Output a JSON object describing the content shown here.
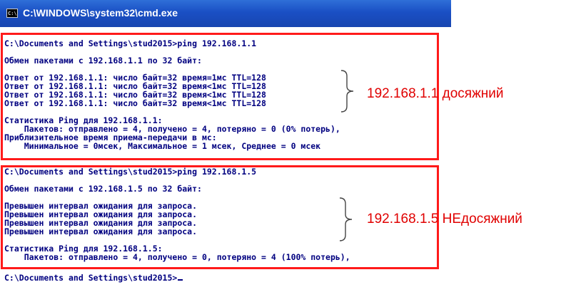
{
  "window": {
    "title": "C:\\WINDOWS\\system32\\cmd.exe",
    "icon_label": "C:\\"
  },
  "console": {
    "lines": [
      "C:\\Documents and Settings\\stud2015>ping 192.168.1.1",
      "",
      "Обмен пакетами с 192.168.1.1 по 32 байт:",
      "",
      "Ответ от 192.168.1.1: число байт=32 время=1мс TTL=128",
      "Ответ от 192.168.1.1: число байт=32 время<1мс TTL=128",
      "Ответ от 192.168.1.1: число байт=32 время<1мс TTL=128",
      "Ответ от 192.168.1.1: число байт=32 время<1мс TTL=128",
      "",
      "Статистика Ping для 192.168.1.1:",
      "    Пакетов: отправлено = 4, получено = 4, потеряно = 0 (0% потерь),",
      "Приблизительное время приема-передачи в мс:",
      "    Минимальное = 0мсек, Максимальное = 1 мсек, Среднее = 0 мсек",
      "C:\\Documents and Settings\\stud2015>ping 192.168.1.5",
      "",
      "Обмен пакетами с 192.168.1.5 по 32 байт:",
      "",
      "Превышен интервал ожидания для запроса.",
      "Превышен интервал ожидания для запроса.",
      "Превышен интервал ожидания для запроса.",
      "Превышен интервал ожидания для запроса.",
      "",
      "Статистика Ping для 192.168.1.5:",
      "    Пакетов: отправлено = 4, получено = 0, потеряно = 4 (100% потерь),",
      "",
      "C:\\Documents and Settings\\stud2015>"
    ]
  },
  "annotations": {
    "reachable": "192.168.1.1 досяжний",
    "unreachable": "192.168.1.5 НЕдосяжний",
    "color": "#ff1a1a"
  }
}
